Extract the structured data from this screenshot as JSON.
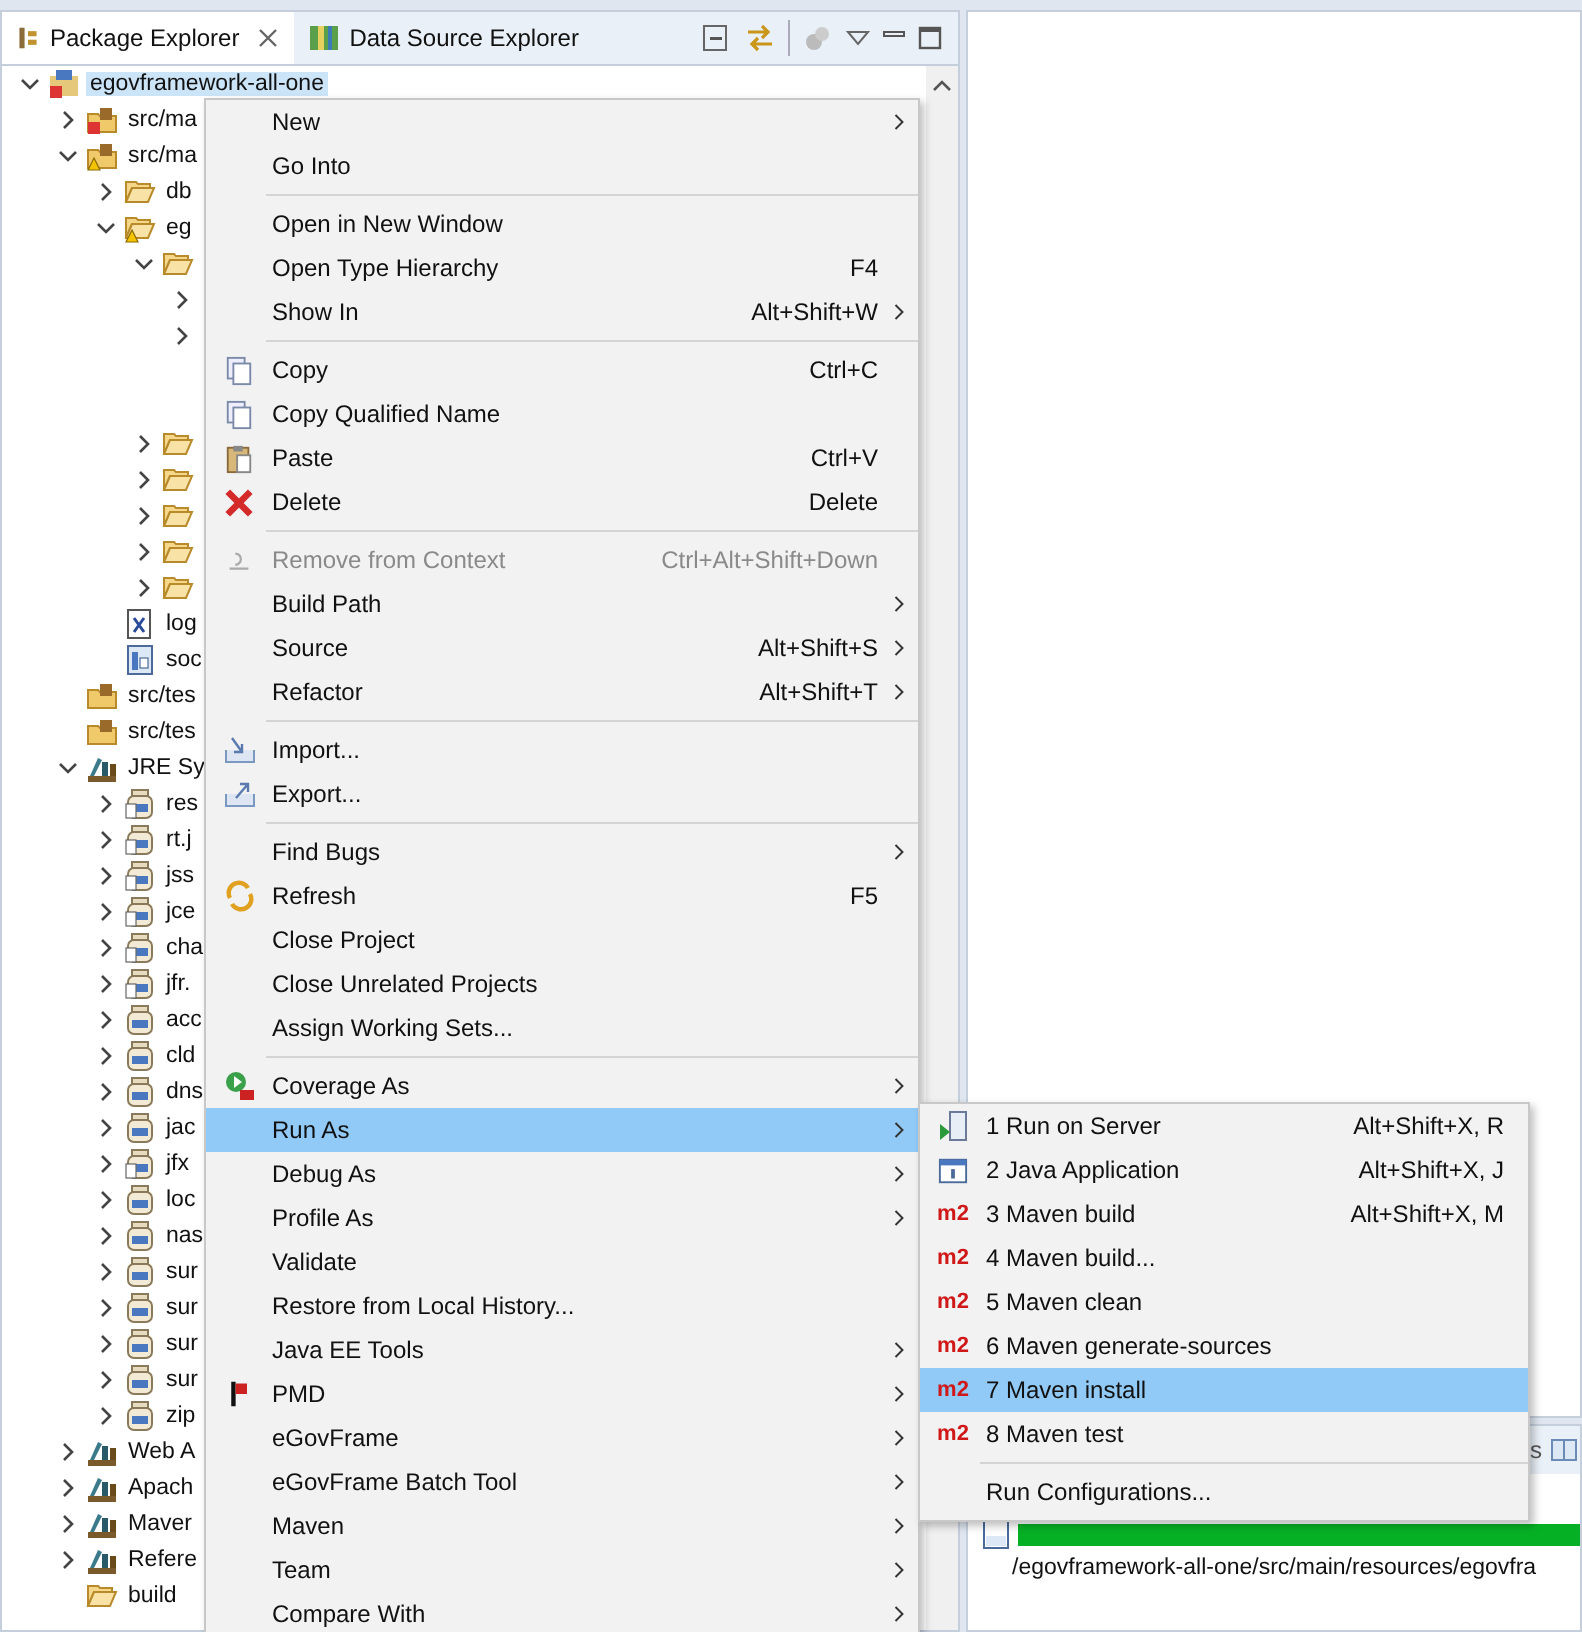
{
  "tabs": [
    {
      "label": "Package Explorer",
      "selected": true,
      "closable": true
    },
    {
      "label": "Data Source Explorer",
      "selected": false,
      "closable": false
    }
  ],
  "tree": [
    {
      "label": "egovframework-all-one",
      "kind": "project",
      "expanded": true,
      "selected": true,
      "children": [
        {
          "label": "src/ma",
          "kind": "srcroot-error",
          "expanded": false,
          "selected": false
        },
        {
          "label": "src/ma",
          "kind": "srcroot-warn",
          "expanded": true,
          "selected": false,
          "children": [
            {
              "label": "db",
              "kind": "folder",
              "expanded": false,
              "selected": false
            },
            {
              "label": "eg",
              "kind": "folder-warn",
              "expanded": true,
              "selected": false,
              "children": [
                {
                  "kind": "folder",
                  "expanded": true,
                  "children": [
                    {
                      "kind": "hidden",
                      "expanded": false
                    },
                    {
                      "kind": "hidden",
                      "expanded": false
                    },
                    {
                      "kind": "blank"
                    },
                    {
                      "kind": "blank"
                    }
                  ]
                },
                {
                  "kind": "folder",
                  "expanded": false
                },
                {
                  "kind": "folder",
                  "expanded": false
                },
                {
                  "kind": "folder",
                  "expanded": false
                },
                {
                  "kind": "folder",
                  "expanded": false
                },
                {
                  "kind": "folder",
                  "expanded": false
                }
              ]
            },
            {
              "label": "log",
              "kind": "xml",
              "selected": false
            },
            {
              "label": "soc",
              "kind": "file",
              "selected": false
            }
          ]
        },
        {
          "label": "src/tes",
          "kind": "srcfolder",
          "selected": false
        },
        {
          "label": "src/tes",
          "kind": "srcfolder",
          "selected": false
        },
        {
          "label": "JRE Sy",
          "kind": "library",
          "expanded": true,
          "selected": false,
          "children": [
            {
              "label": "res",
              "kind": "jar-src",
              "expanded": false,
              "selected": false
            },
            {
              "label": "rt.j",
              "kind": "jar-src",
              "expanded": false,
              "selected": false
            },
            {
              "label": "jss",
              "kind": "jar-src",
              "expanded": false,
              "selected": false
            },
            {
              "label": "jce",
              "kind": "jar-src",
              "expanded": false,
              "selected": false
            },
            {
              "label": "cha",
              "kind": "jar-src",
              "expanded": false,
              "selected": false
            },
            {
              "label": "jfr.",
              "kind": "jar-src",
              "expanded": false,
              "selected": false
            },
            {
              "label": "acc",
              "kind": "jar",
              "expanded": false,
              "selected": false
            },
            {
              "label": "cld",
              "kind": "jar",
              "expanded": false,
              "selected": false
            },
            {
              "label": "dns",
              "kind": "jar",
              "expanded": false,
              "selected": false
            },
            {
              "label": "jac",
              "kind": "jar",
              "expanded": false,
              "selected": false
            },
            {
              "label": "jfx",
              "kind": "jar-src",
              "expanded": false,
              "selected": false
            },
            {
              "label": "loc",
              "kind": "jar",
              "expanded": false,
              "selected": false
            },
            {
              "label": "nas",
              "kind": "jar",
              "expanded": false,
              "selected": false
            },
            {
              "label": "sur",
              "kind": "jar",
              "expanded": false,
              "selected": false
            },
            {
              "label": "sur",
              "kind": "jar",
              "expanded": false,
              "selected": false
            },
            {
              "label": "sur",
              "kind": "jar",
              "expanded": false,
              "selected": false
            },
            {
              "label": "sur",
              "kind": "jar",
              "expanded": false,
              "selected": false
            },
            {
              "label": "zip",
              "kind": "jar",
              "expanded": false,
              "selected": false
            }
          ]
        },
        {
          "label": "Web A",
          "kind": "library",
          "expanded": false,
          "selected": false
        },
        {
          "label": "Apach",
          "kind": "library",
          "expanded": false,
          "selected": false
        },
        {
          "label": "Maver",
          "kind": "library",
          "expanded": false,
          "selected": false
        },
        {
          "label": "Refere",
          "kind": "library",
          "expanded": false,
          "selected": false
        },
        {
          "label": "build",
          "kind": "folder",
          "selected": false
        }
      ]
    }
  ],
  "context_menu": [
    {
      "kind": "item",
      "label": "New",
      "submenu": true,
      "disabled": false,
      "selected": false
    },
    {
      "kind": "item",
      "label": "Go Into",
      "submenu": false,
      "disabled": false,
      "selected": false
    },
    {
      "kind": "separator"
    },
    {
      "kind": "item",
      "label": "Open in New Window",
      "submenu": false,
      "disabled": false,
      "selected": false
    },
    {
      "kind": "item",
      "label": "Open Type Hierarchy",
      "shortcut": "F4",
      "submenu": false,
      "disabled": false,
      "selected": false
    },
    {
      "kind": "item",
      "label": "Show In",
      "shortcut": "Alt+Shift+W",
      "submenu": true,
      "disabled": false,
      "selected": false
    },
    {
      "kind": "separator"
    },
    {
      "kind": "copy",
      "label": "Copy",
      "shortcut": "Ctrl+C",
      "submenu": false,
      "disabled": false,
      "selected": false
    },
    {
      "kind": "copy",
      "label": "Copy Qualified Name",
      "submenu": false,
      "disabled": false,
      "selected": false
    },
    {
      "kind": "paste",
      "label": "Paste",
      "shortcut": "Ctrl+V",
      "submenu": false,
      "disabled": false,
      "selected": false
    },
    {
      "kind": "delete",
      "label": "Delete",
      "shortcut": "Delete",
      "submenu": false,
      "disabled": false,
      "selected": false
    },
    {
      "kind": "separator"
    },
    {
      "kind": "remove",
      "label": "Remove from Context",
      "shortcut": "Ctrl+Alt+Shift+Down",
      "submenu": false,
      "disabled": true,
      "selected": false
    },
    {
      "kind": "item",
      "label": "Build Path",
      "submenu": true,
      "disabled": false,
      "selected": false
    },
    {
      "kind": "item",
      "label": "Source",
      "shortcut": "Alt+Shift+S",
      "submenu": true,
      "disabled": false,
      "selected": false
    },
    {
      "kind": "item",
      "label": "Refactor",
      "shortcut": "Alt+Shift+T",
      "submenu": true,
      "disabled": false,
      "selected": false
    },
    {
      "kind": "separator"
    },
    {
      "kind": "import",
      "label": "Import...",
      "submenu": false,
      "disabled": false,
      "selected": false
    },
    {
      "kind": "export",
      "label": "Export...",
      "submenu": false,
      "disabled": false,
      "selected": false
    },
    {
      "kind": "separator"
    },
    {
      "kind": "item",
      "label": "Find Bugs",
      "submenu": true,
      "disabled": false,
      "selected": false
    },
    {
      "kind": "refresh",
      "label": "Refresh",
      "shortcut": "F5",
      "submenu": false,
      "disabled": false,
      "selected": false
    },
    {
      "kind": "item",
      "label": "Close Project",
      "submenu": false,
      "disabled": false,
      "selected": false
    },
    {
      "kind": "item",
      "label": "Close Unrelated Projects",
      "submenu": false,
      "disabled": false,
      "selected": false
    },
    {
      "kind": "item",
      "label": "Assign Working Sets...",
      "submenu": false,
      "disabled": false,
      "selected": false
    },
    {
      "kind": "separator"
    },
    {
      "kind": "coverage",
      "label": "Coverage As",
      "submenu": true,
      "disabled": false,
      "selected": false
    },
    {
      "kind": "item",
      "label": "Run As",
      "submenu": true,
      "disabled": false,
      "selected": true
    },
    {
      "kind": "item",
      "label": "Debug As",
      "submenu": true,
      "disabled": false,
      "selected": false
    },
    {
      "kind": "item",
      "label": "Profile As",
      "submenu": true,
      "disabled": false,
      "selected": false
    },
    {
      "kind": "item",
      "label": "Validate",
      "submenu": false,
      "disabled": false,
      "selected": false
    },
    {
      "kind": "item",
      "label": "Restore from Local History...",
      "submenu": false,
      "disabled": false,
      "selected": false
    },
    {
      "kind": "item",
      "label": "Java EE Tools",
      "submenu": true,
      "disabled": false,
      "selected": false
    },
    {
      "kind": "flag",
      "label": "PMD",
      "submenu": true,
      "disabled": false,
      "selected": false
    },
    {
      "kind": "item",
      "label": "eGovFrame",
      "submenu": true,
      "disabled": false,
      "selected": false
    },
    {
      "kind": "item",
      "label": "eGovFrame Batch Tool",
      "submenu": true,
      "disabled": false,
      "selected": false
    },
    {
      "kind": "item",
      "label": "Maven",
      "submenu": true,
      "disabled": false,
      "selected": false
    },
    {
      "kind": "item",
      "label": "Team",
      "submenu": true,
      "disabled": false,
      "selected": false
    },
    {
      "kind": "item",
      "label": "Compare With",
      "submenu": true,
      "disabled": false,
      "selected": false
    }
  ],
  "run_as_menu": [
    {
      "kind": "server",
      "label": "1 Run on Server",
      "shortcut": "Alt+Shift+X, R",
      "selected": false
    },
    {
      "kind": "java",
      "label": "2 Java Application",
      "shortcut": "Alt+Shift+X, J",
      "selected": false
    },
    {
      "kind": "maven",
      "label": "3 Maven build",
      "shortcut": "Alt+Shift+X, M",
      "badge": "m2",
      "selected": false
    },
    {
      "kind": "maven",
      "label": "4 Maven build...",
      "badge": "m2",
      "selected": false
    },
    {
      "kind": "maven",
      "label": "5 Maven clean",
      "badge": "m2",
      "selected": false
    },
    {
      "kind": "maven",
      "label": "6 Maven generate-sources",
      "badge": "m2",
      "selected": false
    },
    {
      "kind": "maven",
      "label": "7 Maven install",
      "badge": "m2",
      "selected": true
    },
    {
      "kind": "maven",
      "label": "8 Maven test",
      "badge": "m2",
      "selected": false
    },
    {
      "kind": "separator"
    },
    {
      "kind": "item",
      "label": "Run Configurations...",
      "selected": false
    }
  ],
  "bottom_panel": {
    "tab_fragment": "s",
    "progress": {
      "level": 1
    },
    "path": "/egovframework-all-one/src/main/resources/egovfra"
  }
}
